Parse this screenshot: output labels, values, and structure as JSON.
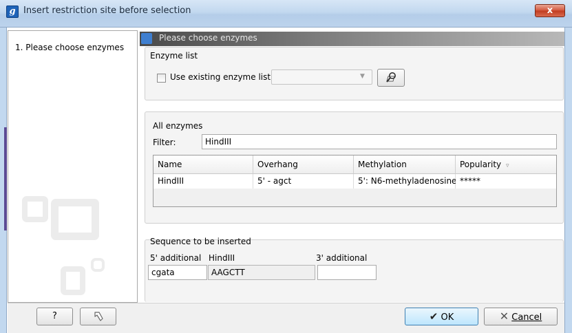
{
  "window": {
    "title": "Insert restriction site before selection",
    "app_icon_letter": "g",
    "close_symbol": "x"
  },
  "steps": [
    {
      "label": "1.  Please choose enzymes"
    }
  ],
  "header": {
    "title": "Please choose enzymes"
  },
  "enzyme_list": {
    "legend": "Enzyme list",
    "use_existing_label": "Use existing enzyme list",
    "use_existing_checked": false,
    "combo_value": "",
    "browse_icon": "search-folder-icon"
  },
  "all_enzymes": {
    "legend": "All enzymes",
    "filter_label": "Filter:",
    "filter_value": "HindIII",
    "columns": [
      "Name",
      "Overhang",
      "Methylation",
      "Popularity"
    ],
    "rows": [
      [
        "HindIII",
        "5' - agct",
        "5': N6-methyladenosine",
        "*****"
      ]
    ]
  },
  "sequence": {
    "legend": "Sequence to be inserted",
    "five_prime_label": "5' additional",
    "site_label": "HindIII",
    "three_prime_label": "3' additional",
    "five_prime_value": "cgata",
    "site_value": "AAGCTT",
    "three_prime_value": ""
  },
  "buttons": {
    "help": "?",
    "ok": "OK",
    "cancel": "Cancel"
  },
  "colors": {
    "title_bar": "#c2d8ef",
    "header_bar": "#7a7a7a",
    "accent_blue": "#3f7fd0",
    "close_red": "#c03b1f"
  }
}
